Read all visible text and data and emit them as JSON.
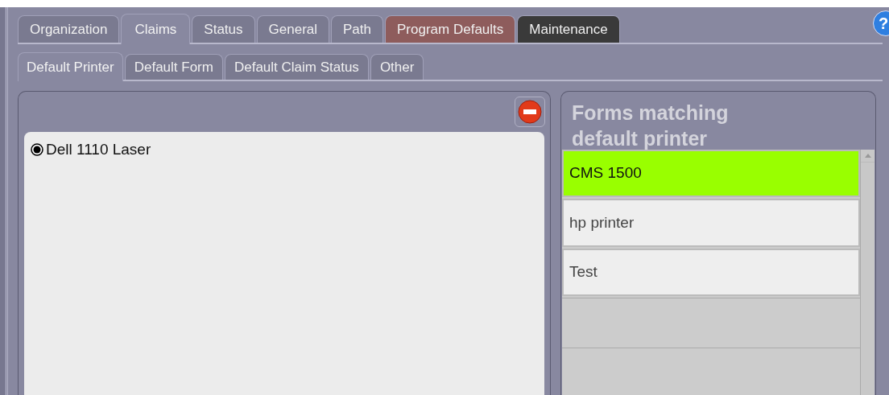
{
  "tabs": [
    {
      "label": "Organization",
      "selected": false,
      "color": "#7a7a90"
    },
    {
      "label": "Claims",
      "selected": true,
      "color": "#8888a0"
    },
    {
      "label": "Status",
      "selected": false,
      "color": "#7a7a90"
    },
    {
      "label": "General",
      "selected": false,
      "color": "#7a7a90"
    },
    {
      "label": "Path",
      "selected": false,
      "color": "#7a7a90"
    },
    {
      "label": "Program Defaults",
      "selected": false,
      "color": "#8e5c5c"
    },
    {
      "label": "Maintenance",
      "selected": false,
      "color": "#3a3a3a"
    }
  ],
  "help_button": {
    "label": "?"
  },
  "subtabs": [
    {
      "label": "Default Printer",
      "selected": true
    },
    {
      "label": "Default Form",
      "selected": false
    },
    {
      "label": "Default Claim Status",
      "selected": false
    },
    {
      "label": "Other",
      "selected": false
    }
  ],
  "printers": [
    {
      "label": "Dell 1110 Laser",
      "selected": true
    }
  ],
  "forms_panel": {
    "title": "Forms matching default printer",
    "forms": [
      {
        "label": "CMS 1500",
        "selected": true
      },
      {
        "label": "hp printer",
        "selected": false
      },
      {
        "label": "Test",
        "selected": false
      }
    ]
  }
}
